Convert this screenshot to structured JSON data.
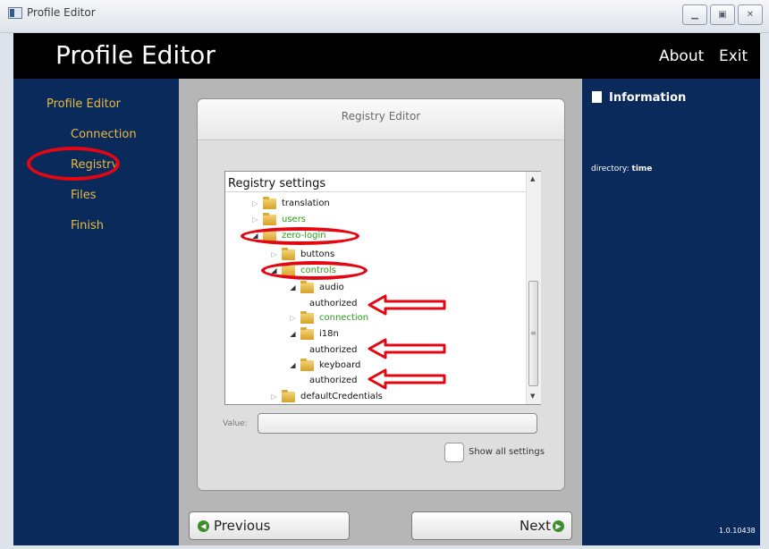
{
  "window": {
    "title": "Profile Editor",
    "controls": [
      "minimize",
      "maximize",
      "close"
    ]
  },
  "header": {
    "app_title": "Profile Editor",
    "about_label": "About",
    "exit_label": "Exit"
  },
  "nav": {
    "root_label": "Profile Editor",
    "items": [
      {
        "label": "Connection"
      },
      {
        "label": "Registry",
        "highlighted": true
      },
      {
        "label": "Files"
      },
      {
        "label": "Finish"
      }
    ]
  },
  "panel": {
    "title": "Registry Editor",
    "tree_header": "Registry settings",
    "tree": [
      {
        "label": "translation",
        "folder": true,
        "expanded": false
      },
      {
        "label": "users",
        "folder": true,
        "expanded": false,
        "color": "green"
      },
      {
        "label": "zero-login",
        "folder": true,
        "expanded": true,
        "color": "green",
        "highlighted": true
      },
      {
        "label": "buttons",
        "folder": true,
        "expanded": false
      },
      {
        "label": "controls",
        "folder": true,
        "expanded": true,
        "color": "green",
        "highlighted": true
      },
      {
        "label": "audio",
        "folder": true,
        "expanded": true
      },
      {
        "label": "authorized",
        "folder": false,
        "pointed": true
      },
      {
        "label": "connection",
        "folder": true,
        "expanded": false,
        "color": "green"
      },
      {
        "label": "i18n",
        "folder": true,
        "expanded": true
      },
      {
        "label": "authorized",
        "folder": false,
        "pointed": true
      },
      {
        "label": "keyboard",
        "folder": true,
        "expanded": true
      },
      {
        "label": "authorized",
        "folder": false,
        "pointed": true
      },
      {
        "label": "defaultCredentials",
        "folder": true,
        "expanded": false
      }
    ],
    "value_label": "Value:",
    "value": "",
    "show_all_label": "Show all settings",
    "show_all_checked": false
  },
  "footer": {
    "previous_label": "Previous",
    "next_label": "Next"
  },
  "info": {
    "title": "Information",
    "directory_key": "directory:",
    "directory_value": "time",
    "version": "1.0.10438"
  },
  "colors": {
    "nav_bg": "#0b2a5c",
    "nav_text": "#e8bb40",
    "highlight": "#e40611",
    "tree_green": "#2a9a19",
    "header_bg": "#000000",
    "center_bg": "#b6b6b6"
  },
  "icons": [
    "window-app-icon",
    "minimize-icon",
    "maximize-icon",
    "close-icon",
    "folder-icon",
    "expand-arrow-icon",
    "collapse-arrow-icon",
    "document-icon",
    "arrow-left-icon",
    "arrow-right-icon",
    "annotation-arrow-icon"
  ]
}
